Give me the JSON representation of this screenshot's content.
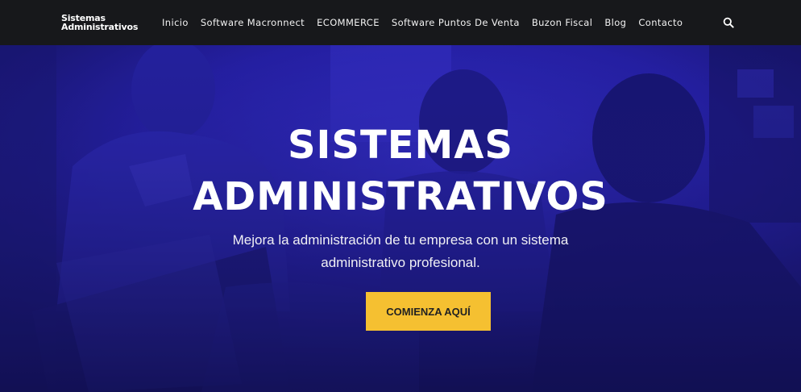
{
  "header": {
    "logo_line1": "Sistemas",
    "logo_line2": "Administrativos",
    "nav": [
      {
        "label": "Inicio"
      },
      {
        "label": "Software Macronnect"
      },
      {
        "label": "ECOMMERCE"
      },
      {
        "label": "Software Puntos De Venta"
      },
      {
        "label": "Buzon Fiscal"
      },
      {
        "label": "Blog"
      },
      {
        "label": "Contacto"
      }
    ],
    "search_icon": "search-icon"
  },
  "hero": {
    "title_line1": "SISTEMAS",
    "title_line2": "ADMINISTRATIVOS",
    "subtitle_line1": "Mejora la administración de tu empresa con un sistema",
    "subtitle_line2": "administrativo profesional.",
    "cta_label": "COMIENZA AQUÍ",
    "overlay_color": "#1f1c8f",
    "cta_color": "#f5c031"
  }
}
